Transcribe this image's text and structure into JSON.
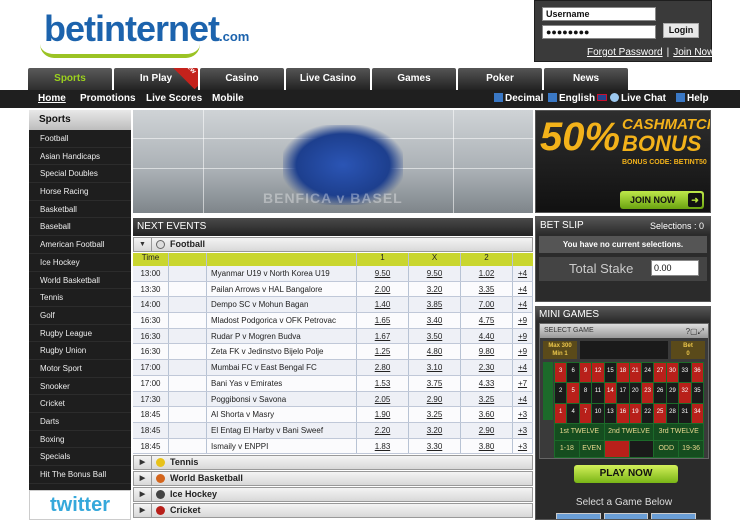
{
  "logo": {
    "bet": "bet",
    "internet": "internet",
    "dom": ".com"
  },
  "login": {
    "username": "Username",
    "password": "●●●●●●●●",
    "button": "Login",
    "forgot": "Forgot Password",
    "sep": "|",
    "join": "Join Now"
  },
  "tabs": [
    {
      "label": "Sports"
    },
    {
      "label": "In Play",
      "badge": "New"
    },
    {
      "label": "Casino"
    },
    {
      "label": "Live Casino"
    },
    {
      "label": "Games"
    },
    {
      "label": "Poker"
    },
    {
      "label": "News"
    }
  ],
  "subnav": {
    "home": "Home",
    "promotions": "Promotions",
    "live_scores": "Live Scores",
    "mobile": "Mobile",
    "decimal": "Decimal",
    "english": "English",
    "live_chat": "Live Chat",
    "help": "Help"
  },
  "sidebar": {
    "title": "Sports",
    "items": [
      "Football",
      "Asian Handicaps",
      "Special Doubles",
      "Horse Racing",
      "Basketball",
      "Baseball",
      "American Football",
      "Ice Hockey",
      "World Basketball",
      "Tennis",
      "Golf",
      "Rugby League",
      "Rugby Union",
      "Motor Sport",
      "Snooker",
      "Cricket",
      "Darts",
      "Boxing",
      "Specials",
      "Hit The Bonus Ball"
    ]
  },
  "twitter": "twitter",
  "banner": {
    "text": "BENFICA v BASEL"
  },
  "events": {
    "title": "NEXT EVENTS",
    "open_sport": "Football",
    "columns": {
      "time": "Time",
      "one": "1",
      "x": "X",
      "two": "2"
    },
    "rows": [
      {
        "time": "13:00",
        "match": "Myanmar U19 v North Korea U19",
        "one": "9.50",
        "x": "9.50",
        "two": "1.02",
        "more": "+4"
      },
      {
        "time": "13:30",
        "match": "Pailan Arrows v HAL Bangalore",
        "one": "2.00",
        "x": "3.20",
        "two": "3.35",
        "more": "+4"
      },
      {
        "time": "14:00",
        "match": "Dempo SC v Mohun Bagan",
        "one": "1.40",
        "x": "3.85",
        "two": "7.00",
        "more": "+4"
      },
      {
        "time": "16:30",
        "match": "Mladost Podgorica v OFK Petrovac",
        "one": "1.65",
        "x": "3.40",
        "two": "4.75",
        "more": "+9"
      },
      {
        "time": "16:30",
        "match": "Rudar P v Mogren Budva",
        "one": "1.67",
        "x": "3.50",
        "two": "4.40",
        "more": "+9"
      },
      {
        "time": "16:30",
        "match": "Zeta FK v Jedinstvo Bijelo Polje",
        "one": "1.25",
        "x": "4.80",
        "two": "9.80",
        "more": "+9"
      },
      {
        "time": "17:00",
        "match": "Mumbai FC v East Bengal FC",
        "one": "2.80",
        "x": "3.10",
        "two": "2.30",
        "more": "+4"
      },
      {
        "time": "17:00",
        "match": "Bani Yas v Emirates",
        "one": "1.53",
        "x": "3.75",
        "two": "4.33",
        "more": "+7"
      },
      {
        "time": "17:30",
        "match": "Poggibonsi v Savona",
        "one": "2.05",
        "x": "2.90",
        "two": "3.25",
        "more": "+4"
      },
      {
        "time": "18:45",
        "match": "Al Shorta v Masry",
        "one": "1.90",
        "x": "3.25",
        "two": "3.60",
        "more": "+3"
      },
      {
        "time": "18:45",
        "match": "El Entag El Harby v Bani Sweef",
        "one": "2.20",
        "x": "3.20",
        "two": "2.90",
        "more": "+3"
      },
      {
        "time": "18:45",
        "match": "Ismaily v ENPPI",
        "one": "1.83",
        "x": "3.30",
        "two": "3.80",
        "more": "+3"
      }
    ],
    "collapsed_sports": [
      {
        "name": "Tennis",
        "color": "#e8c21a"
      },
      {
        "name": "World Basketball",
        "color": "#d4651c"
      },
      {
        "name": "Ice Hockey",
        "color": "#444444"
      },
      {
        "name": "Cricket",
        "color": "#b8201a"
      }
    ]
  },
  "promo": {
    "pct": "50%",
    "headline1": "CASHMATCH",
    "headline2": "BONUS",
    "code": "BONUS CODE: BETINT50",
    "join": "JOIN NOW"
  },
  "betslip": {
    "title": "BET SLIP",
    "selections": "Selections : 0",
    "empty": "You have no current selections.",
    "stake_label": "Total Stake",
    "stake_value": "0.00"
  },
  "minigames": {
    "title": "MINI GAMES",
    "select": "SELECT GAME",
    "max_label": "Max 300",
    "min_label": "Min 1",
    "bet_label": "Bet",
    "bet_value": "0",
    "dozens": [
      "1st TWELVE",
      "2nd TWELVE",
      "3rd TWELVE"
    ],
    "outside": [
      "1-18",
      "EVEN",
      "",
      "",
      "ODD",
      "19-36"
    ],
    "play": "PLAY NOW",
    "select_below": "Select a Game Below"
  },
  "colors": {
    "accent_green": "#9bd11e",
    "brand_blue": "#1c63ad",
    "header_yellow": "#c9d62f",
    "bonus_gold": "#f3b21a"
  }
}
